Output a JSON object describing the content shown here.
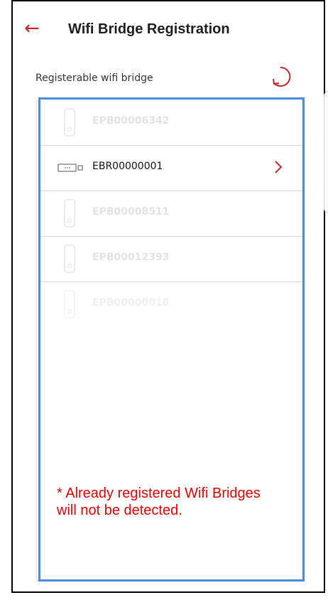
{
  "header": {
    "title": "Wifi Bridge Registration",
    "back_icon": "arrow-left-icon"
  },
  "section": {
    "label": "Registerable wifi bridge",
    "refresh_icon": "refresh-icon"
  },
  "devices": [
    {
      "id": "EPB00006342",
      "icon": "plug-device-icon",
      "state": "disabled"
    },
    {
      "id": "EBR00000001",
      "icon": "wifi-bridge-icon",
      "state": "active"
    },
    {
      "id": "EPB00008511",
      "icon": "plug-device-icon",
      "state": "disabled"
    },
    {
      "id": "EPB00012393",
      "icon": "plug-device-icon",
      "state": "disabled"
    },
    {
      "id": "EPB00000018",
      "icon": "plug-device-icon",
      "state": "faint"
    }
  ],
  "notice": "* Already registered Wifi Bridges\n  will not be detected.",
  "colors": {
    "accent": "#c62828",
    "highlight": "#4a8de0",
    "notice": "#e00000"
  }
}
